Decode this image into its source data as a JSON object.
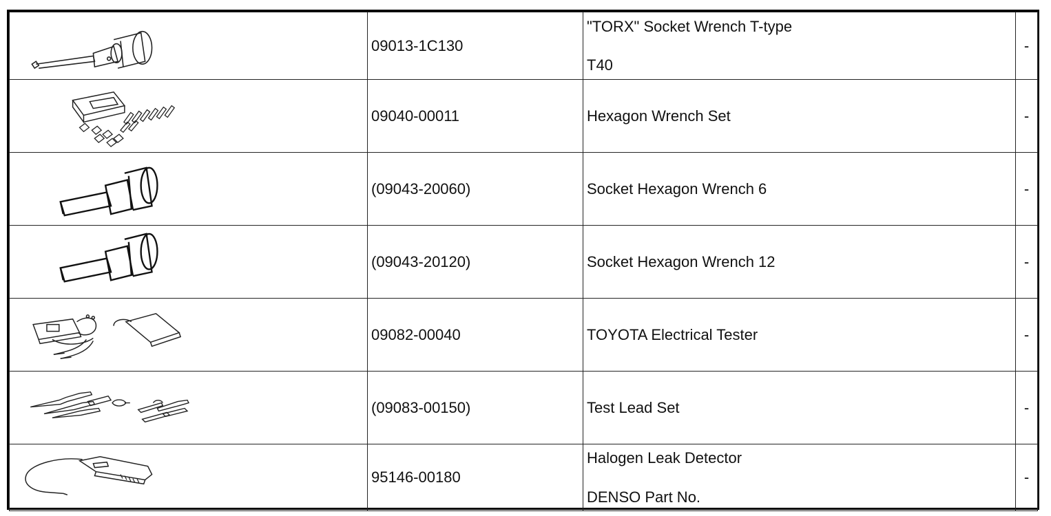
{
  "tools": [
    {
      "icon": "torx-socket-wrench-illustration",
      "part_no": "09013-1C130",
      "name": "\"TORX\" Socket Wrench T-type",
      "note": "T40",
      "remark": "-"
    },
    {
      "icon": "hexagon-wrench-set-illustration",
      "part_no": "09040-00011",
      "name": "Hexagon Wrench Set",
      "note": "",
      "remark": "-"
    },
    {
      "icon": "socket-hexagon-wrench-illustration",
      "part_no": "(09043-20060)",
      "name": "Socket Hexagon Wrench 6",
      "note": "",
      "remark": "-"
    },
    {
      "icon": "socket-hexagon-wrench-illustration",
      "part_no": "(09043-20120)",
      "name": "Socket Hexagon Wrench 12",
      "note": "",
      "remark": "-"
    },
    {
      "icon": "electrical-tester-illustration",
      "part_no": "09082-00040",
      "name": "TOYOTA Electrical Tester",
      "note": "",
      "remark": "-"
    },
    {
      "icon": "test-lead-set-illustration",
      "part_no": "(09083-00150)",
      "name": "Test Lead Set",
      "note": "",
      "remark": "-"
    },
    {
      "icon": "leak-detector-illustration",
      "part_no": "95146-00180",
      "name": "Halogen Leak Detector",
      "note": "DENSO Part No.",
      "remark": "-"
    }
  ]
}
